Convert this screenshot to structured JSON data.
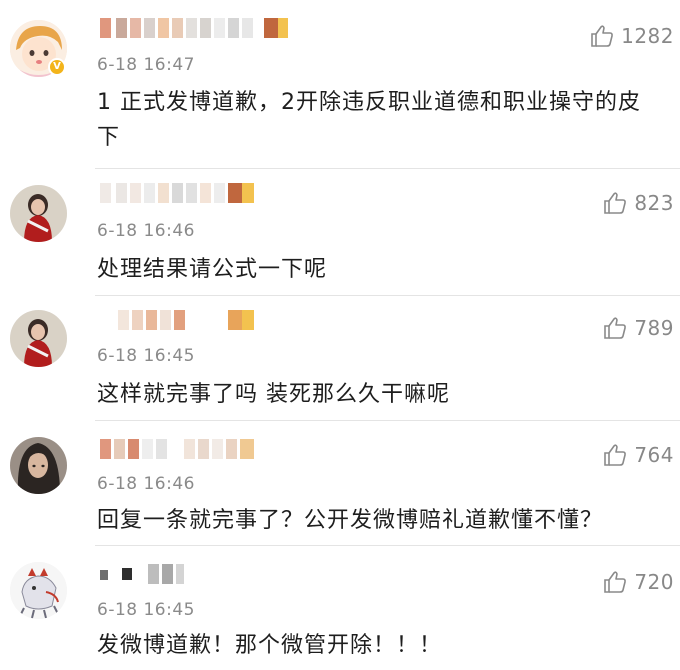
{
  "comments": [
    {
      "time": "6-18 16:47",
      "likes": "1282",
      "text": "1 正式发博道歉，2开除违反职业道德和职业操守的皮下",
      "verified_badge": "V"
    },
    {
      "time": "6-18 16:46",
      "likes": "823",
      "text": "处理结果请公式一下呢"
    },
    {
      "time": "6-18 16:45",
      "likes": "789",
      "text": "这样就完事了吗 装死那么久干嘛呢"
    },
    {
      "time": "6-18 16:46",
      "likes": "764",
      "text": "回复一条就完事了？公开发微博赔礼道歉懂不懂？"
    },
    {
      "time": "6-18 16:45",
      "likes": "720",
      "text": "发微博道歉！那个微管开除！！！"
    }
  ],
  "colors": {
    "text": "#1e1e1e",
    "meta": "#8a8a8a",
    "badge": "#f3b41b",
    "divider": "#e4e4e4"
  },
  "icons": {
    "like": "thumbs-up-icon"
  }
}
